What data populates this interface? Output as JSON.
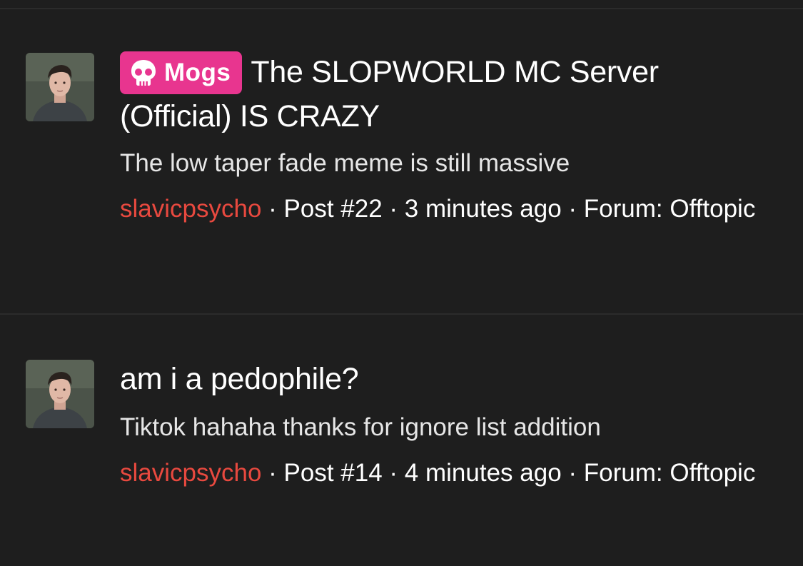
{
  "results": [
    {
      "prefix": "Mogs",
      "title": "The SLOPWORLD MC Server (Official) IS CRAZY",
      "snippet": "The low taper fade meme is still massive",
      "username": "slavicpsycho",
      "sep1": " · ",
      "post": "Post #22",
      "sep2": " · ",
      "time": "3 minutes ago",
      "sep3": " · ",
      "forum_label": "Forum: ",
      "forum": "Offtopic"
    },
    {
      "title": "am i a pedophile?",
      "snippet": "Tiktok hahaha thanks for ignore list addition",
      "username": "slavicpsycho",
      "sep1": " · ",
      "post": "Post #14",
      "sep2": " · ",
      "time": "4 minutes ago",
      "sep3": " · ",
      "forum_label": "Forum: ",
      "forum": "Offtopic"
    }
  ],
  "colors": {
    "background": "#1e1e1e",
    "prefix_badge": "#e8358f",
    "username": "#e8493f",
    "divider": "#2b2b2b"
  },
  "icons": {
    "prefix_icon": "skull-icon",
    "avatar": "user-avatar"
  }
}
